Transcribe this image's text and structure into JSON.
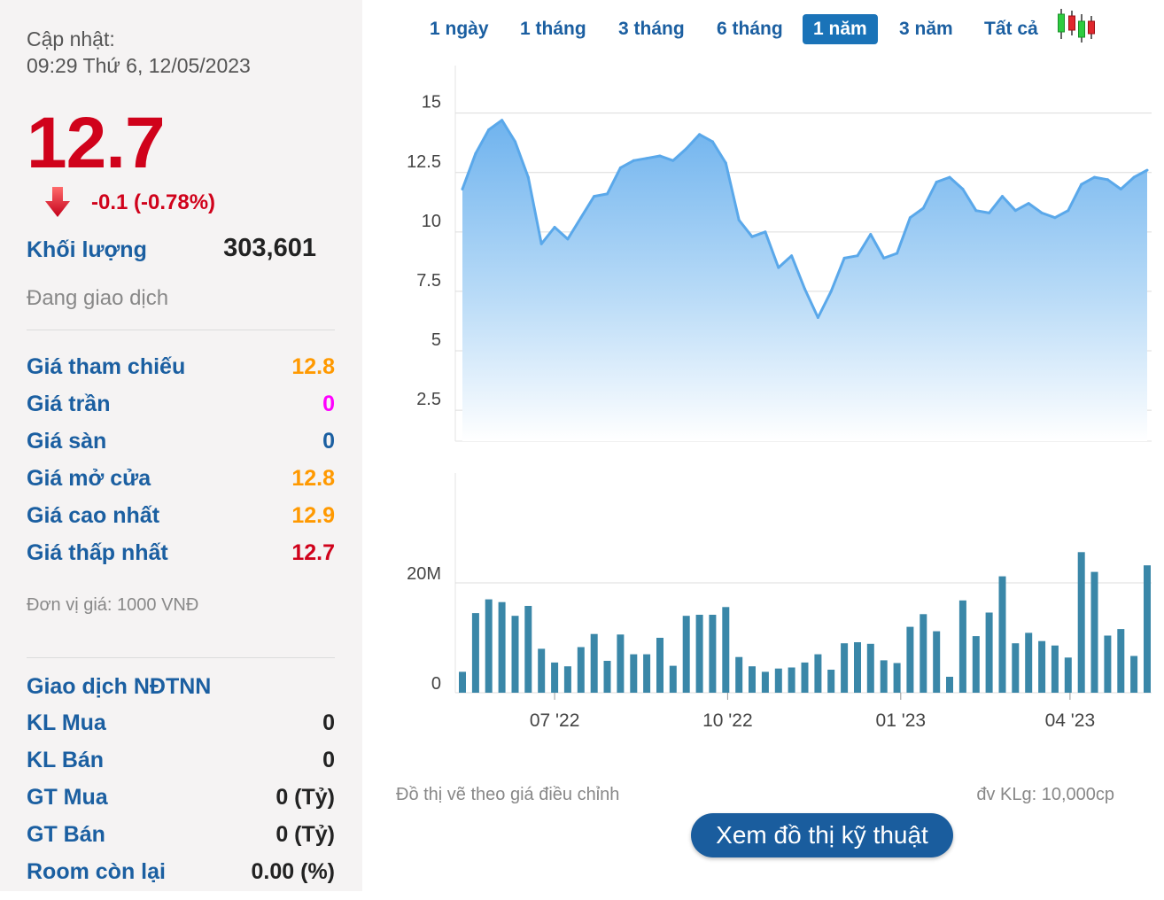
{
  "info": {
    "updated_label": "Cập nhật:",
    "updated_time": "09:29 Thứ 6, 12/05/2023",
    "price": "12.7",
    "change": "-0.1 (-0.78%)",
    "volume_label": "Khối lượng",
    "volume_value": "303,601",
    "status": "Đang giao dịch",
    "unit": "Đơn vị giá: 1000 VNĐ",
    "up_color": "#d0021b"
  },
  "prices": [
    {
      "label": "Giá tham chiếu",
      "value": "12.8",
      "color": "#ff9900"
    },
    {
      "label": "Giá trần",
      "value": "0",
      "color": "#ff00ff"
    },
    {
      "label": "Giá sàn",
      "value": "0",
      "color": "#1b5fa1"
    },
    {
      "label": "Giá mở cửa",
      "value": "12.8",
      "color": "#ff9900"
    },
    {
      "label": "Giá cao nhất",
      "value": "12.9",
      "color": "#ff9900"
    },
    {
      "label": "Giá thấp nhất",
      "value": "12.7",
      "color": "#d0021b"
    }
  ],
  "foreign": {
    "title": "Giao dịch NĐTNN",
    "rows": [
      {
        "label": "KL Mua",
        "value": "0"
      },
      {
        "label": "KL Bán",
        "value": "0"
      },
      {
        "label": "GT Mua",
        "value": "0 (Tỷ)"
      },
      {
        "label": "GT Bán",
        "value": "0 (Tỷ)"
      },
      {
        "label": "Room còn lại",
        "value": "0.00 (%)"
      }
    ]
  },
  "tabs": [
    "1 ngày",
    "1 tháng",
    "3 tháng",
    "6 tháng",
    "1 năm",
    "3 năm",
    "Tất cả"
  ],
  "active_tab": "1 năm",
  "candle_icon": "candlestick-chart-icon",
  "notes": {
    "adjusted": "Đồ thị vẽ theo giá điều chỉnh",
    "volume_unit": "đv KLg: 10,000cp"
  },
  "tech_button": "Xem đồ thị kỹ thuật",
  "chart_data": [
    {
      "type": "area",
      "name": "price",
      "ylim": [
        1.2,
        17
      ],
      "yticks": [
        2.5,
        5,
        7.5,
        10,
        12.5,
        15
      ],
      "ytick_labels": [
        "2.5",
        "5",
        "7.5",
        "10",
        "12.5",
        "15"
      ],
      "grid": true,
      "x": [
        "2022-05-13",
        "2022-05-20",
        "2022-05-27",
        "2022-06-03",
        "2022-06-10",
        "2022-06-17",
        "2022-06-24",
        "2022-07-01",
        "2022-07-08",
        "2022-07-15",
        "2022-07-22",
        "2022-07-29",
        "2022-08-05",
        "2022-08-12",
        "2022-08-19",
        "2022-08-26",
        "2022-09-02",
        "2022-09-09",
        "2022-09-16",
        "2022-09-23",
        "2022-09-30",
        "2022-10-07",
        "2022-10-14",
        "2022-10-21",
        "2022-10-28",
        "2022-11-04",
        "2022-11-11",
        "2022-11-18",
        "2022-11-25",
        "2022-12-02",
        "2022-12-09",
        "2022-12-16",
        "2022-12-23",
        "2022-12-30",
        "2023-01-06",
        "2023-01-13",
        "2023-01-20",
        "2023-01-27",
        "2023-02-03",
        "2023-02-10",
        "2023-02-17",
        "2023-02-24",
        "2023-03-03",
        "2023-03-10",
        "2023-03-17",
        "2023-03-24",
        "2023-03-31",
        "2023-04-07",
        "2023-04-14",
        "2023-04-21",
        "2023-04-28",
        "2023-05-05",
        "2023-05-12"
      ],
      "values": [
        11.8,
        13.3,
        14.3,
        14.7,
        13.8,
        12.3,
        9.5,
        10.2,
        9.7,
        10.6,
        11.5,
        11.6,
        12.7,
        13.0,
        13.1,
        13.2,
        13.0,
        13.5,
        14.1,
        13.8,
        12.9,
        10.5,
        9.8,
        10.0,
        8.5,
        9.0,
        7.6,
        6.4,
        7.5,
        8.9,
        9.0,
        9.9,
        8.9,
        9.1,
        10.6,
        11.0,
        12.1,
        12.3,
        11.8,
        10.9,
        10.8,
        11.5,
        10.9,
        11.2,
        10.8,
        10.6,
        10.9,
        12.0,
        12.3,
        12.2,
        11.8,
        12.3,
        12.6
      ]
    },
    {
      "type": "bar",
      "name": "volume",
      "ylim": [
        0,
        40
      ],
      "yticks": [
        0,
        20
      ],
      "ytick_labels": [
        "0",
        "20M"
      ],
      "grid": true,
      "xtick_labels": [
        "07 '22",
        "10 '22",
        "01 '23",
        "04 '23"
      ],
      "xtick_dates": [
        "2022-07-01",
        "2022-10-01",
        "2023-01-01",
        "2023-04-01"
      ],
      "x": [
        "2022-05-13",
        "2022-05-20",
        "2022-05-27",
        "2022-06-03",
        "2022-06-10",
        "2022-06-17",
        "2022-06-24",
        "2022-07-01",
        "2022-07-08",
        "2022-07-15",
        "2022-07-22",
        "2022-07-29",
        "2022-08-05",
        "2022-08-12",
        "2022-08-19",
        "2022-08-26",
        "2022-09-02",
        "2022-09-09",
        "2022-09-16",
        "2022-09-23",
        "2022-09-30",
        "2022-10-07",
        "2022-10-14",
        "2022-10-21",
        "2022-10-28",
        "2022-11-04",
        "2022-11-11",
        "2022-11-18",
        "2022-11-25",
        "2022-12-02",
        "2022-12-09",
        "2022-12-16",
        "2022-12-23",
        "2022-12-30",
        "2023-01-06",
        "2023-01-13",
        "2023-01-20",
        "2023-01-27",
        "2023-02-03",
        "2023-02-10",
        "2023-02-17",
        "2023-02-24",
        "2023-03-03",
        "2023-03-10",
        "2023-03-17",
        "2023-03-24",
        "2023-03-31",
        "2023-04-07",
        "2023-04-14",
        "2023-04-21",
        "2023-04-28",
        "2023-05-05",
        "2023-05-12"
      ],
      "values": [
        3.8,
        14.5,
        17.0,
        16.5,
        14.0,
        15.8,
        8.0,
        5.5,
        4.8,
        8.3,
        10.7,
        5.8,
        10.6,
        7.0,
        7.0,
        10.0,
        4.9,
        14.0,
        14.2,
        14.2,
        15.6,
        6.5,
        4.8,
        3.8,
        4.4,
        4.6,
        5.5,
        7.0,
        4.2,
        9.0,
        9.2,
        8.9,
        5.9,
        5.4,
        12.0,
        14.3,
        11.2,
        2.9,
        16.8,
        10.3,
        14.6,
        21.2,
        9.0,
        10.9,
        9.4,
        8.6,
        6.4,
        25.6,
        22.0,
        10.4,
        11.6,
        6.7,
        23.2
      ]
    }
  ]
}
